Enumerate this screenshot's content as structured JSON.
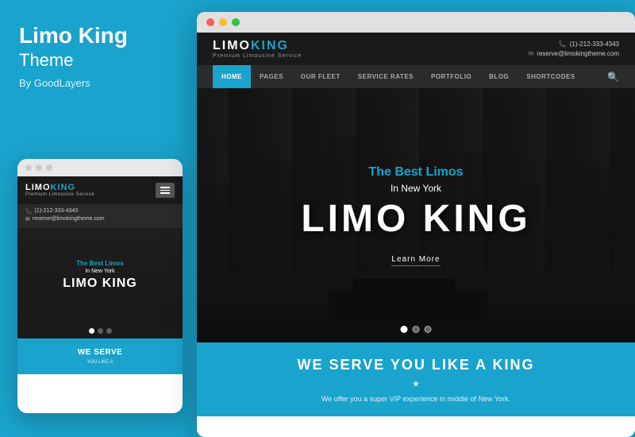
{
  "left": {
    "title_bold": "Limo King",
    "title_light": "Theme",
    "author": "By GoodLayers"
  },
  "mobile": {
    "logo_limo": "LIMO",
    "logo_king": "KING",
    "logo_sub": "Premium Limousine Service",
    "phone": "(1)-212-333-4343",
    "email": "reserve@limokingtheme.com",
    "hero_tagline": "The Best Limos",
    "hero_subtitle": "In New York",
    "hero_title": "LIMO KING",
    "serve_title": "WE SERVE",
    "serve_sub": "YOU LIKE A"
  },
  "desktop": {
    "logo_limo": "LIMO",
    "logo_king": "KING",
    "logo_sub": "Premium Limousine Service",
    "phone": "(1)-212-333-4343",
    "email": "reserve@limokingtheme.com",
    "nav": {
      "items": [
        "HOME",
        "PAGES",
        "OUR FLEET",
        "SERVICE RATES",
        "PORTFOLIO",
        "BLOG",
        "SHORTCODES"
      ]
    },
    "hero": {
      "tagline": "The Best Limos",
      "subtitle": "In New York",
      "title": "LIMO KING",
      "learn_more": "Learn More"
    },
    "serve": {
      "title": "WE SERVE YOU LIKE A KING",
      "star": "★",
      "text": "We offer you a super VIP experience in middle of New York."
    }
  },
  "colors": {
    "accent": "#1aa3cc",
    "dark": "#1a1a1a",
    "white": "#ffffff"
  }
}
